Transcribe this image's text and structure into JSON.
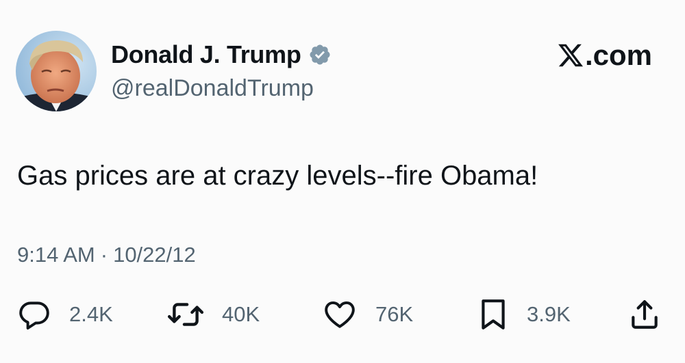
{
  "author": {
    "display_name": "Donald J. Trump",
    "handle": "@realDonaldTrump",
    "verified": true,
    "avatar_icon": "profile-photo"
  },
  "brand": {
    "logo_icon": "x-logo-icon",
    "text": ".com"
  },
  "tweet": {
    "text": "Gas prices are at crazy levels--fire Obama!",
    "time": "9:14 AM",
    "separator": "·",
    "date": "10/22/12"
  },
  "actions": {
    "reply": {
      "icon": "reply-icon",
      "count": "2.4K"
    },
    "retweet": {
      "icon": "retweet-icon",
      "count": "40K"
    },
    "like": {
      "icon": "heart-icon",
      "count": "76K"
    },
    "bookmark": {
      "icon": "bookmark-icon",
      "count": "3.9K"
    },
    "share": {
      "icon": "share-icon"
    }
  },
  "colors": {
    "background": "#fbfbfb",
    "text_primary": "#0f1419",
    "text_secondary": "#536471",
    "verified_badge": "#829aab"
  }
}
